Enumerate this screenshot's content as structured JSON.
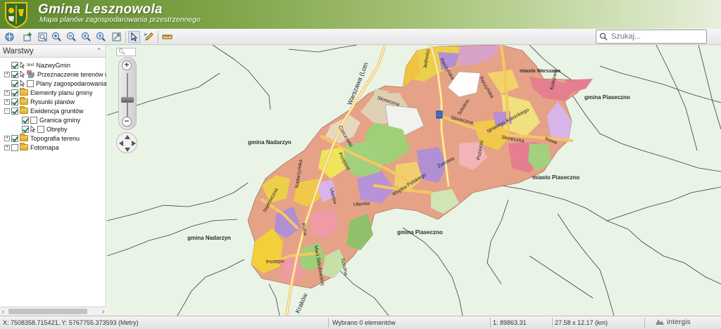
{
  "header": {
    "title": "Gmina Lesznowola",
    "subtitle": "Mapa planów zagospodarowania przestrzennego"
  },
  "toolbar": {
    "tools": [
      "layers-tool-icon",
      "add-layer-icon",
      "zoom-extent-icon",
      "zoom-in-icon",
      "zoom-out-icon",
      "zoom-prev-icon",
      "zoom-next-icon",
      "full-extent-icon",
      "select-pointer-icon",
      "edit-pencil-icon",
      "measure-ruler-icon"
    ],
    "active_tool": "select-pointer-icon",
    "search_placeholder": "Szukaj..."
  },
  "layers": {
    "title": "Warstwy",
    "items": [
      {
        "label": "NazwyGmin",
        "checked": true,
        "expander": "",
        "icon": "text"
      },
      {
        "label": "Przeznaczenie terenów w",
        "checked": true,
        "expander": "+",
        "icon": "legend"
      },
      {
        "label": "Plany zagospodarowania",
        "checked": true,
        "expander": "",
        "icon": "blank"
      },
      {
        "label": "Elementy planu gminy",
        "checked": true,
        "expander": "+",
        "icon": "folder"
      },
      {
        "label": "Rysunki planów",
        "checked": true,
        "expander": "+",
        "icon": "folder"
      },
      {
        "label": "Ewidencja gruntów",
        "checked": true,
        "expander": "-",
        "icon": "folder"
      },
      {
        "label": "Granica gminy",
        "checked": true,
        "expander": "",
        "icon": "blank"
      },
      {
        "label": "Obręby",
        "checked": true,
        "expander": "",
        "icon": "blank"
      },
      {
        "label": "Topografia terenu",
        "checked": true,
        "expander": "+",
        "icon": "folder"
      },
      {
        "label": "Fotomapa",
        "checked": false,
        "expander": "+",
        "icon": "folder"
      }
    ],
    "text_icon_label": "text"
  },
  "map": {
    "places": [
      "gmina Nadarzyn",
      "gmina Nadarzyn",
      "gmina Piaseczno",
      "gmina Piaseczno",
      "miasto Piaseczno",
      "miasto Warszawa"
    ],
    "streets": [
      "Warszawa (Lotn",
      "Słoneczna",
      "Słoneczna",
      "Słoneczna",
      "Raszyńska",
      "Raszyńska",
      "Szkolna",
      "Ignacego Krasickiego",
      "Poziomki",
      "Nowa",
      "Jedności",
      "Kolejowa",
      "Czeczowki",
      "Przejazd",
      "Żwirowa",
      "Wojska Polskiego",
      "Nadarzyńska",
      "Nadrzeczna",
      "Polna",
      "Marii Skłodowskiej",
      "Ułanów",
      "Ułanów",
      "Postępu",
      "Kraków",
      "Szkolna"
    ],
    "zoom_search_icon": "magnifier-icon"
  },
  "status": {
    "coords": "X: 7508358.715421, Y: 5767755.373593 (Metry)",
    "selection": "Wybrano 0 elementów",
    "scale": "1: 89863.31",
    "extent": "27.58 x 12.17 (km)",
    "brand": "intergis"
  }
}
